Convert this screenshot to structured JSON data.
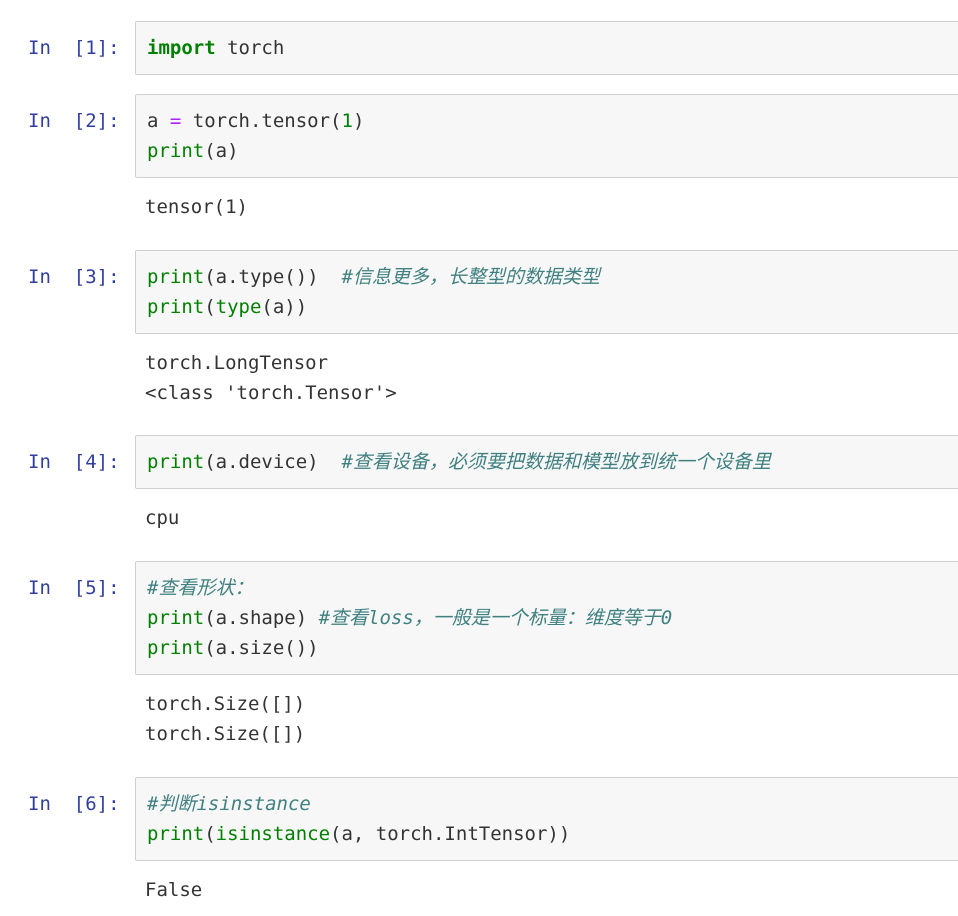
{
  "cells": [
    {
      "prompt": "In  [1]:",
      "code": [
        [
          {
            "t": "import",
            "c": "kw"
          },
          {
            "t": " torch",
            "c": ""
          }
        ]
      ],
      "output": []
    },
    {
      "prompt": "In  [2]:",
      "code": [
        [
          {
            "t": "a ",
            "c": ""
          },
          {
            "t": "=",
            "c": "op"
          },
          {
            "t": " torch.tensor(",
            "c": ""
          },
          {
            "t": "1",
            "c": "num"
          },
          {
            "t": ")",
            "c": ""
          }
        ],
        [
          {
            "t": "print",
            "c": "bi"
          },
          {
            "t": "(a)",
            "c": ""
          }
        ]
      ],
      "output": [
        "tensor(1)"
      ]
    },
    {
      "prompt": "In  [3]:",
      "code": [
        [
          {
            "t": "print",
            "c": "bi"
          },
          {
            "t": "(a.type())  ",
            "c": ""
          },
          {
            "t": "#信息更多，长整型的数据类型",
            "c": "cm"
          }
        ],
        [
          {
            "t": "print",
            "c": "bi"
          },
          {
            "t": "(",
            "c": ""
          },
          {
            "t": "type",
            "c": "bi"
          },
          {
            "t": "(a))",
            "c": ""
          }
        ]
      ],
      "output": [
        "torch.LongTensor",
        "<class 'torch.Tensor'>"
      ]
    },
    {
      "prompt": "In  [4]:",
      "code": [
        [
          {
            "t": "print",
            "c": "bi"
          },
          {
            "t": "(a.device)  ",
            "c": ""
          },
          {
            "t": "#查看设备，必须要把数据和模型放到统一个设备里",
            "c": "cm"
          }
        ]
      ],
      "output": [
        "cpu"
      ]
    },
    {
      "prompt": "In  [5]:",
      "code": [
        [
          {
            "t": "#查看形状：",
            "c": "cm"
          }
        ],
        [
          {
            "t": "print",
            "c": "bi"
          },
          {
            "t": "(a.shape) ",
            "c": ""
          },
          {
            "t": "#查看loss，一般是一个标量：维度等于0",
            "c": "cm"
          }
        ],
        [
          {
            "t": "print",
            "c": "bi"
          },
          {
            "t": "(a.size())",
            "c": ""
          }
        ]
      ],
      "output": [
        "torch.Size([])",
        "torch.Size([])"
      ]
    },
    {
      "prompt": "In  [6]:",
      "code": [
        [
          {
            "t": "#判断isinstance",
            "c": "cm"
          }
        ],
        [
          {
            "t": "print",
            "c": "bi"
          },
          {
            "t": "(",
            "c": ""
          },
          {
            "t": "isinstance",
            "c": "bi"
          },
          {
            "t": "(a, torch.IntTensor))",
            "c": ""
          }
        ]
      ],
      "output": [
        "False"
      ]
    }
  ]
}
